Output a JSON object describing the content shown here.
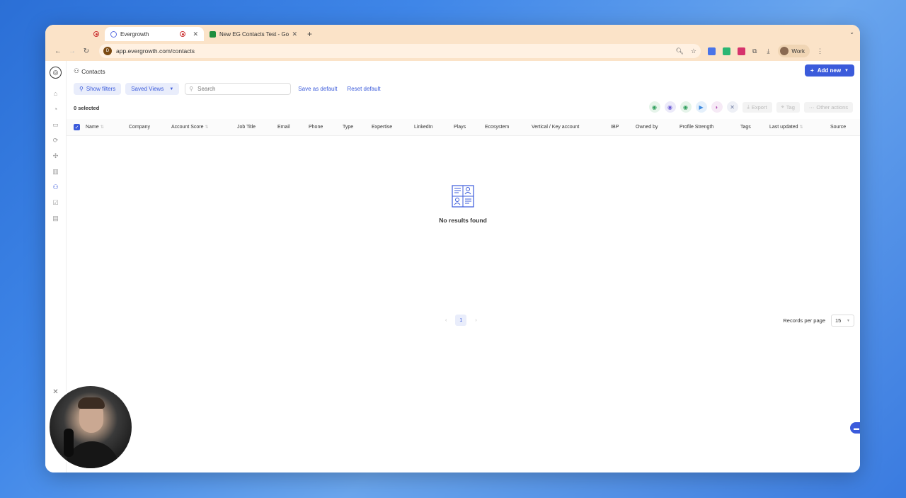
{
  "browser": {
    "tabs": [
      {
        "title": "Evergrowth",
        "favicon_color": "#5b6ee1"
      },
      {
        "title": "New EG Contacts Test - Goog",
        "favicon_color": "#1e8e3e"
      }
    ],
    "url": "app.evergrowth.com/contacts",
    "profile": "Work",
    "site_icon": "D"
  },
  "app": {
    "page_title": "Contacts",
    "add_new_label": "Add new",
    "filters": {
      "show_filters": "Show filters",
      "saved_views": "Saved Views",
      "search_placeholder": "Search",
      "save_default": "Save as default",
      "reset_default": "Reset default"
    },
    "selected_count": "0 selected",
    "actions": {
      "export": "Export",
      "tag": "Tag",
      "other": "Other actions"
    },
    "columns": [
      "Name",
      "Company",
      "Account Score",
      "Job Title",
      "Email",
      "Phone",
      "Type",
      "Expertise",
      "LinkedIn",
      "Plays",
      "Ecosystem",
      "Vertical / Key account",
      "IBP",
      "Owned by",
      "Profile Strength",
      "Tags",
      "Last updated",
      "Source"
    ],
    "empty_text": "No results found",
    "pagination": {
      "current_page": "1",
      "records_label": "Records per page",
      "records_value": "15"
    },
    "accent_color": "#3b5bdb"
  }
}
